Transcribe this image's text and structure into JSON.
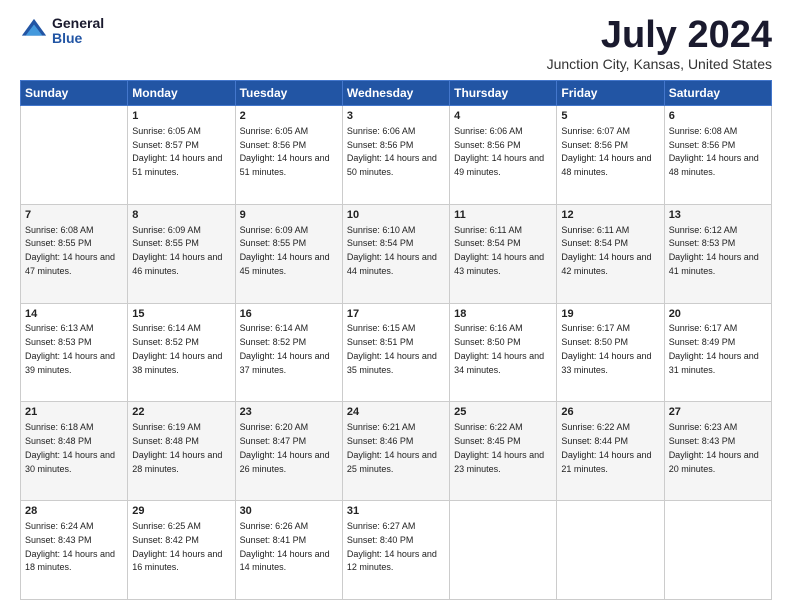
{
  "logo": {
    "general": "General",
    "blue": "Blue"
  },
  "title": "July 2024",
  "location": "Junction City, Kansas, United States",
  "days_of_week": [
    "Sunday",
    "Monday",
    "Tuesday",
    "Wednesday",
    "Thursday",
    "Friday",
    "Saturday"
  ],
  "weeks": [
    [
      {
        "day": "",
        "empty": true
      },
      {
        "day": "1",
        "sunrise": "6:05 AM",
        "sunset": "8:57 PM",
        "daylight": "14 hours and 51 minutes."
      },
      {
        "day": "2",
        "sunrise": "6:05 AM",
        "sunset": "8:56 PM",
        "daylight": "14 hours and 51 minutes."
      },
      {
        "day": "3",
        "sunrise": "6:06 AM",
        "sunset": "8:56 PM",
        "daylight": "14 hours and 50 minutes."
      },
      {
        "day": "4",
        "sunrise": "6:06 AM",
        "sunset": "8:56 PM",
        "daylight": "14 hours and 49 minutes."
      },
      {
        "day": "5",
        "sunrise": "6:07 AM",
        "sunset": "8:56 PM",
        "daylight": "14 hours and 48 minutes."
      },
      {
        "day": "6",
        "sunrise": "6:08 AM",
        "sunset": "8:56 PM",
        "daylight": "14 hours and 48 minutes."
      }
    ],
    [
      {
        "day": "7",
        "sunrise": "6:08 AM",
        "sunset": "8:55 PM",
        "daylight": "14 hours and 47 minutes."
      },
      {
        "day": "8",
        "sunrise": "6:09 AM",
        "sunset": "8:55 PM",
        "daylight": "14 hours and 46 minutes."
      },
      {
        "day": "9",
        "sunrise": "6:09 AM",
        "sunset": "8:55 PM",
        "daylight": "14 hours and 45 minutes."
      },
      {
        "day": "10",
        "sunrise": "6:10 AM",
        "sunset": "8:54 PM",
        "daylight": "14 hours and 44 minutes."
      },
      {
        "day": "11",
        "sunrise": "6:11 AM",
        "sunset": "8:54 PM",
        "daylight": "14 hours and 43 minutes."
      },
      {
        "day": "12",
        "sunrise": "6:11 AM",
        "sunset": "8:54 PM",
        "daylight": "14 hours and 42 minutes."
      },
      {
        "day": "13",
        "sunrise": "6:12 AM",
        "sunset": "8:53 PM",
        "daylight": "14 hours and 41 minutes."
      }
    ],
    [
      {
        "day": "14",
        "sunrise": "6:13 AM",
        "sunset": "8:53 PM",
        "daylight": "14 hours and 39 minutes."
      },
      {
        "day": "15",
        "sunrise": "6:14 AM",
        "sunset": "8:52 PM",
        "daylight": "14 hours and 38 minutes."
      },
      {
        "day": "16",
        "sunrise": "6:14 AM",
        "sunset": "8:52 PM",
        "daylight": "14 hours and 37 minutes."
      },
      {
        "day": "17",
        "sunrise": "6:15 AM",
        "sunset": "8:51 PM",
        "daylight": "14 hours and 35 minutes."
      },
      {
        "day": "18",
        "sunrise": "6:16 AM",
        "sunset": "8:50 PM",
        "daylight": "14 hours and 34 minutes."
      },
      {
        "day": "19",
        "sunrise": "6:17 AM",
        "sunset": "8:50 PM",
        "daylight": "14 hours and 33 minutes."
      },
      {
        "day": "20",
        "sunrise": "6:17 AM",
        "sunset": "8:49 PM",
        "daylight": "14 hours and 31 minutes."
      }
    ],
    [
      {
        "day": "21",
        "sunrise": "6:18 AM",
        "sunset": "8:48 PM",
        "daylight": "14 hours and 30 minutes."
      },
      {
        "day": "22",
        "sunrise": "6:19 AM",
        "sunset": "8:48 PM",
        "daylight": "14 hours and 28 minutes."
      },
      {
        "day": "23",
        "sunrise": "6:20 AM",
        "sunset": "8:47 PM",
        "daylight": "14 hours and 26 minutes."
      },
      {
        "day": "24",
        "sunrise": "6:21 AM",
        "sunset": "8:46 PM",
        "daylight": "14 hours and 25 minutes."
      },
      {
        "day": "25",
        "sunrise": "6:22 AM",
        "sunset": "8:45 PM",
        "daylight": "14 hours and 23 minutes."
      },
      {
        "day": "26",
        "sunrise": "6:22 AM",
        "sunset": "8:44 PM",
        "daylight": "14 hours and 21 minutes."
      },
      {
        "day": "27",
        "sunrise": "6:23 AM",
        "sunset": "8:43 PM",
        "daylight": "14 hours and 20 minutes."
      }
    ],
    [
      {
        "day": "28",
        "sunrise": "6:24 AM",
        "sunset": "8:43 PM",
        "daylight": "14 hours and 18 minutes."
      },
      {
        "day": "29",
        "sunrise": "6:25 AM",
        "sunset": "8:42 PM",
        "daylight": "14 hours and 16 minutes."
      },
      {
        "day": "30",
        "sunrise": "6:26 AM",
        "sunset": "8:41 PM",
        "daylight": "14 hours and 14 minutes."
      },
      {
        "day": "31",
        "sunrise": "6:27 AM",
        "sunset": "8:40 PM",
        "daylight": "14 hours and 12 minutes."
      },
      {
        "day": "",
        "empty": true
      },
      {
        "day": "",
        "empty": true
      },
      {
        "day": "",
        "empty": true
      }
    ]
  ]
}
